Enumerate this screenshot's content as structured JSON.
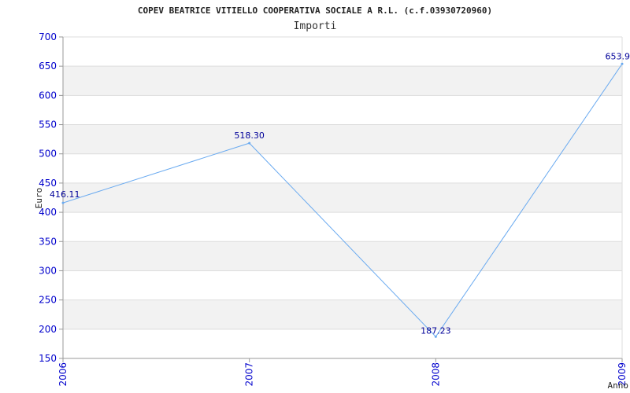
{
  "chart_data": {
    "type": "line",
    "title": "COPEV BEATRICE VITIELLO COOPERATIVA SOCIALE A R.L. (c.f.03930720960)",
    "subtitle": "Importi",
    "xlabel": "Anno",
    "ylabel": "Euro",
    "categories": [
      "2006",
      "2007",
      "2008",
      "2009"
    ],
    "series": [
      {
        "values": [
          416.11,
          518.3,
          187.23,
          653.9
        ],
        "data_labels": [
          "416.11",
          "518.30",
          "187.23",
          "653.9"
        ]
      }
    ],
    "ylim": [
      150,
      700
    ],
    "yticks": [
      150,
      200,
      250,
      300,
      350,
      400,
      450,
      500,
      550,
      600,
      650,
      700
    ],
    "grid": true,
    "colors": {
      "line": "#6aaaf0",
      "tick_text": "#0000cc",
      "label_text": "#000099",
      "band": "#f2f2f2",
      "grid": "#dddddd",
      "axis": "#999999"
    }
  }
}
